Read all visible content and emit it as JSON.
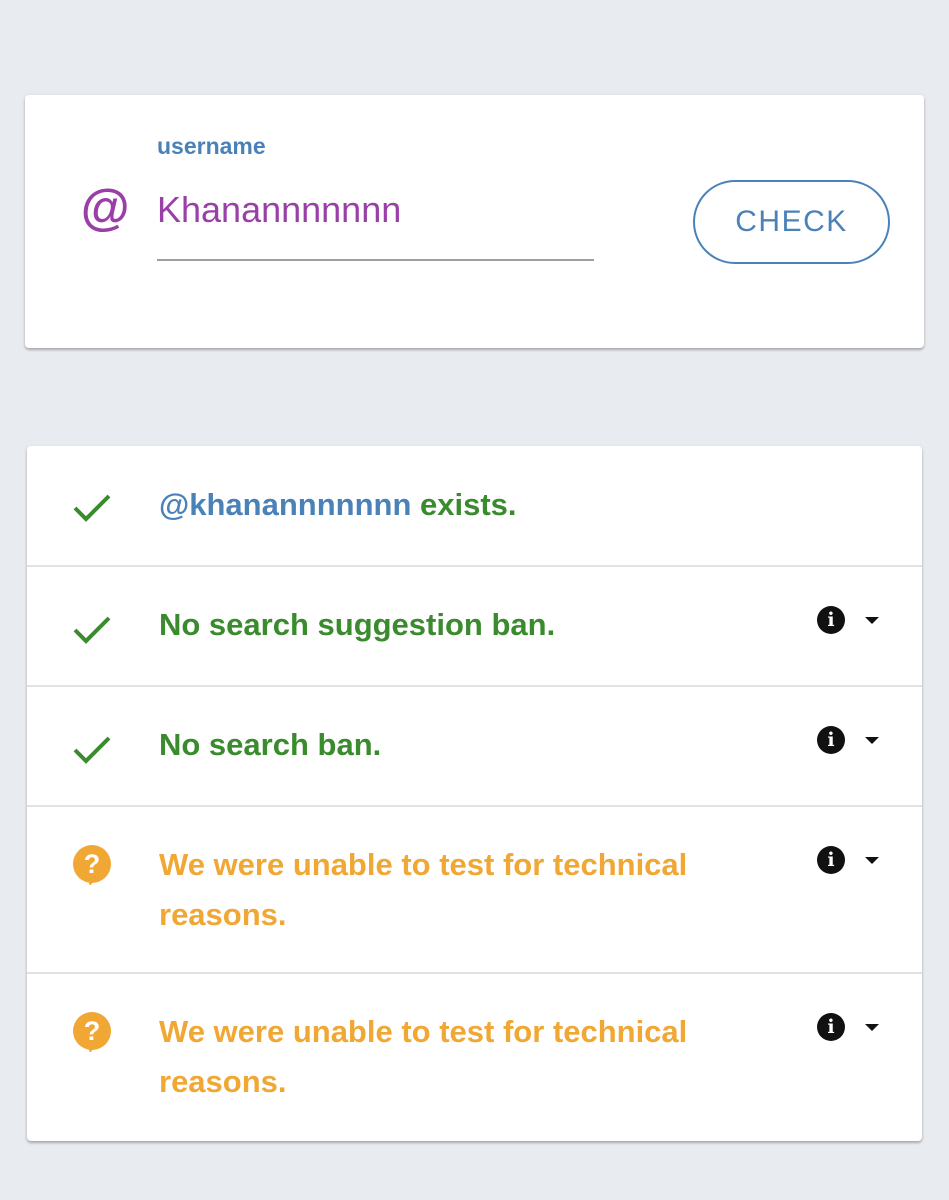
{
  "form": {
    "label": "username",
    "prefix_icon": "at-icon",
    "value": "Khanannnnnnn",
    "button_label": "CHECK"
  },
  "results": [
    {
      "status": "ok",
      "icon": "check-icon",
      "handle": "@khanannnnnnn",
      "text": " exists.",
      "has_info": false
    },
    {
      "status": "ok",
      "icon": "check-icon",
      "text": "No search suggestion ban.",
      "has_info": true
    },
    {
      "status": "ok",
      "icon": "check-icon",
      "text": "No search ban.",
      "has_info": true
    },
    {
      "status": "unknown",
      "icon": "question-bubble-icon",
      "text": "We were unable to test for technical reasons.",
      "has_info": true
    },
    {
      "status": "unknown",
      "icon": "question-bubble-icon",
      "text": "We were unable to test for technical reasons.",
      "has_info": true
    }
  ],
  "info_glyph": "i",
  "colors": {
    "accent": "#4a82b8",
    "username": "#9a3fa8",
    "ok": "#3a8a2e",
    "warning": "#f0a733",
    "background": "#e8ebef"
  }
}
